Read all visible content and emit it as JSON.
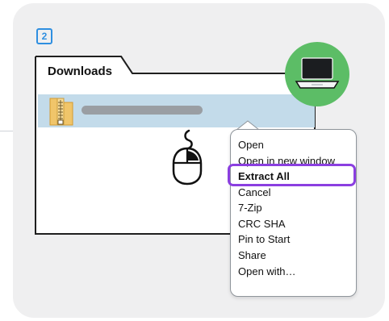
{
  "step": {
    "number": "2"
  },
  "folder": {
    "title": "Downloads",
    "selected_item_icon": "zip-folder-icon"
  },
  "device_badge": {
    "icon": "laptop-icon",
    "color": "#5cbd66"
  },
  "pointer": {
    "icon": "right-click-mouse-icon"
  },
  "context_menu": {
    "items": [
      {
        "label": "Open",
        "emphasis": false
      },
      {
        "label": "Open in new window",
        "emphasis": false
      },
      {
        "label": "Extract All",
        "emphasis": true
      },
      {
        "label": "Cancel",
        "emphasis": false
      },
      {
        "label": "7-Zip",
        "emphasis": false
      },
      {
        "label": "CRC SHA",
        "emphasis": false
      },
      {
        "label": "Pin to Start",
        "emphasis": false
      },
      {
        "label": "Share",
        "emphasis": false
      },
      {
        "label": "Open with…",
        "emphasis": false
      }
    ],
    "highlight_color": "#8b3fe0"
  },
  "colors": {
    "accent_blue": "#2f8fe0",
    "selection": "#c3dbea",
    "card_background": "#efeff0"
  }
}
